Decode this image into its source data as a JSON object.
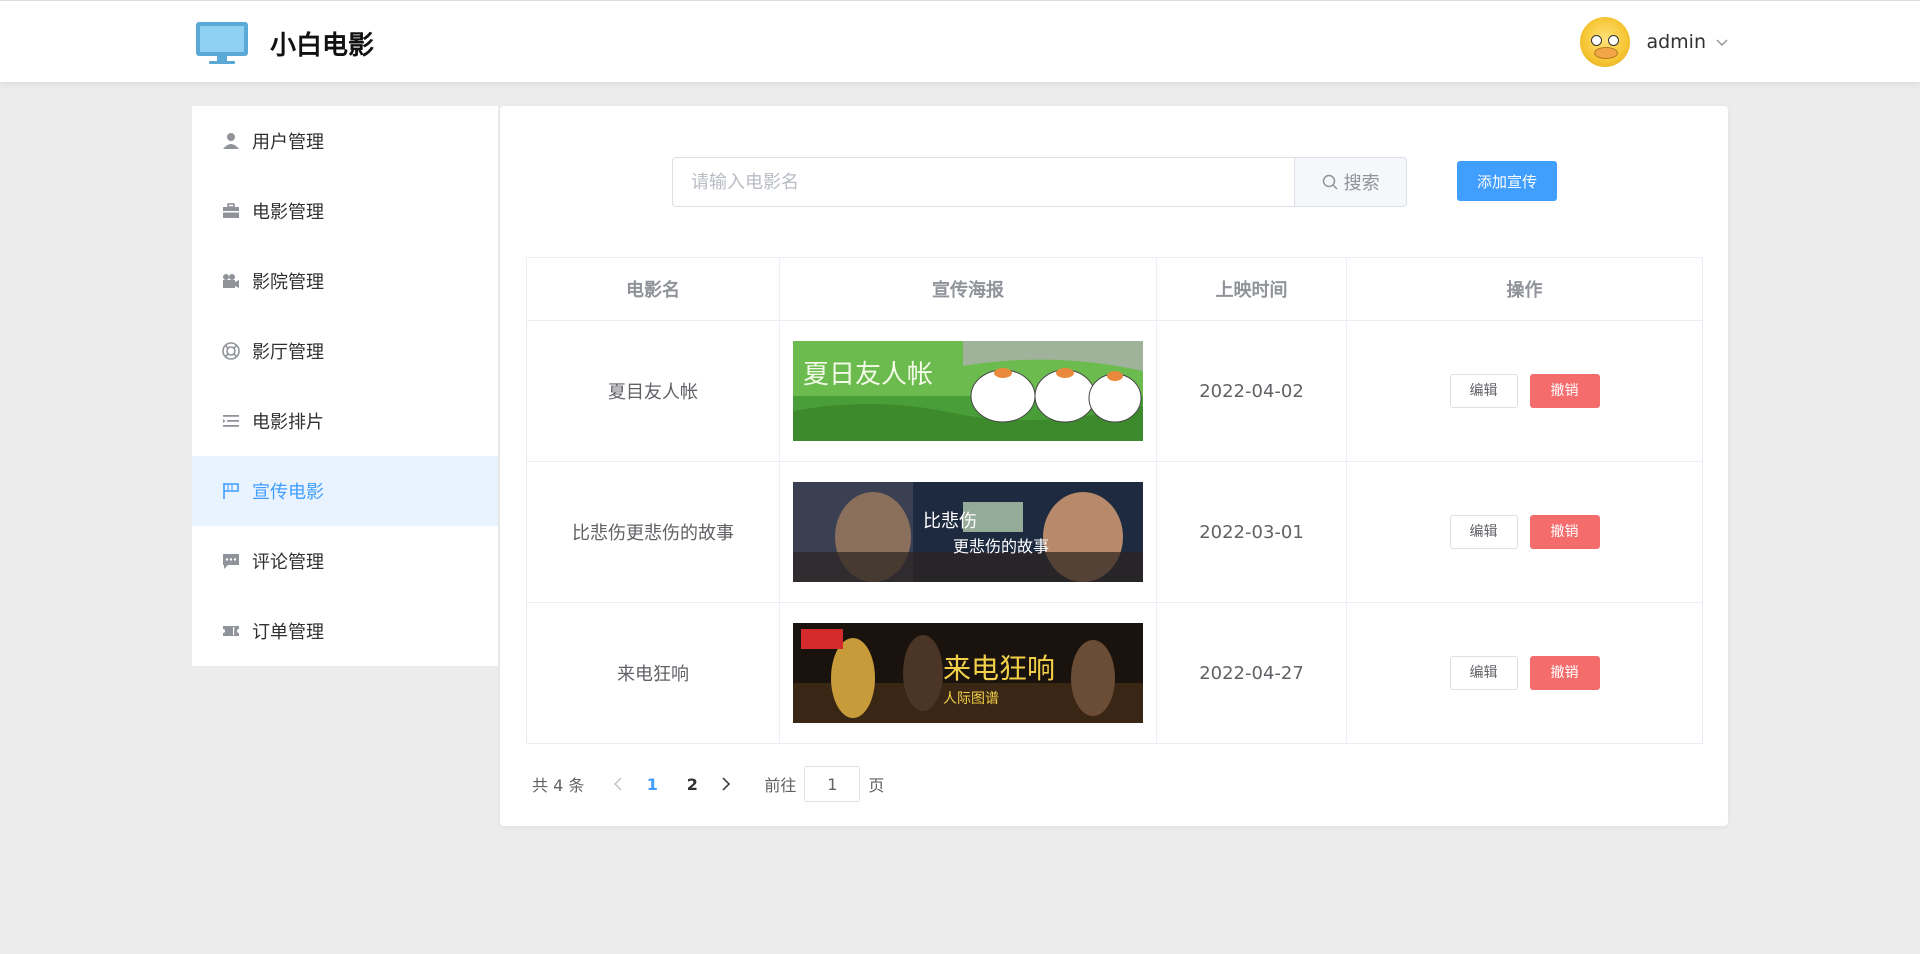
{
  "header": {
    "site_title": "小白电影",
    "username": "admin"
  },
  "sidebar": {
    "items": [
      {
        "label": "用户管理",
        "icon": "user-icon"
      },
      {
        "label": "电影管理",
        "icon": "briefcase-icon"
      },
      {
        "label": "影院管理",
        "icon": "camera-icon"
      },
      {
        "label": "影厅管理",
        "icon": "lifebuoy-icon"
      },
      {
        "label": "电影排片",
        "icon": "indent-list-icon"
      },
      {
        "label": "宣传电影",
        "icon": "flag-icon",
        "active": true
      },
      {
        "label": "评论管理",
        "icon": "comment-icon"
      },
      {
        "label": "订单管理",
        "icon": "ticket-icon"
      }
    ]
  },
  "search": {
    "placeholder": "请输入电影名",
    "value": "",
    "button_label": "搜索"
  },
  "add_button_label": "添加宣传",
  "table": {
    "headers": [
      "电影名",
      "宣传海报",
      "上映时间",
      "操作"
    ],
    "rows": [
      {
        "name": "夏目友人帐",
        "date": "2022-04-02",
        "edit": "编辑",
        "revoke": "撤销"
      },
      {
        "name": "比悲伤更悲伤的故事",
        "date": "2022-03-01",
        "edit": "编辑",
        "revoke": "撤销"
      },
      {
        "name": "来电狂响",
        "date": "2022-04-27",
        "edit": "编辑",
        "revoke": "撤销"
      }
    ]
  },
  "pagination": {
    "total_text": "共 4 条",
    "pages": [
      "1",
      "2"
    ],
    "current_page": "1",
    "goto_label": "前往",
    "goto_value": "1",
    "page_suffix": "页"
  },
  "colors": {
    "primary": "#409eff",
    "danger": "#f56c6c",
    "active_bg": "#e8f3ff"
  }
}
